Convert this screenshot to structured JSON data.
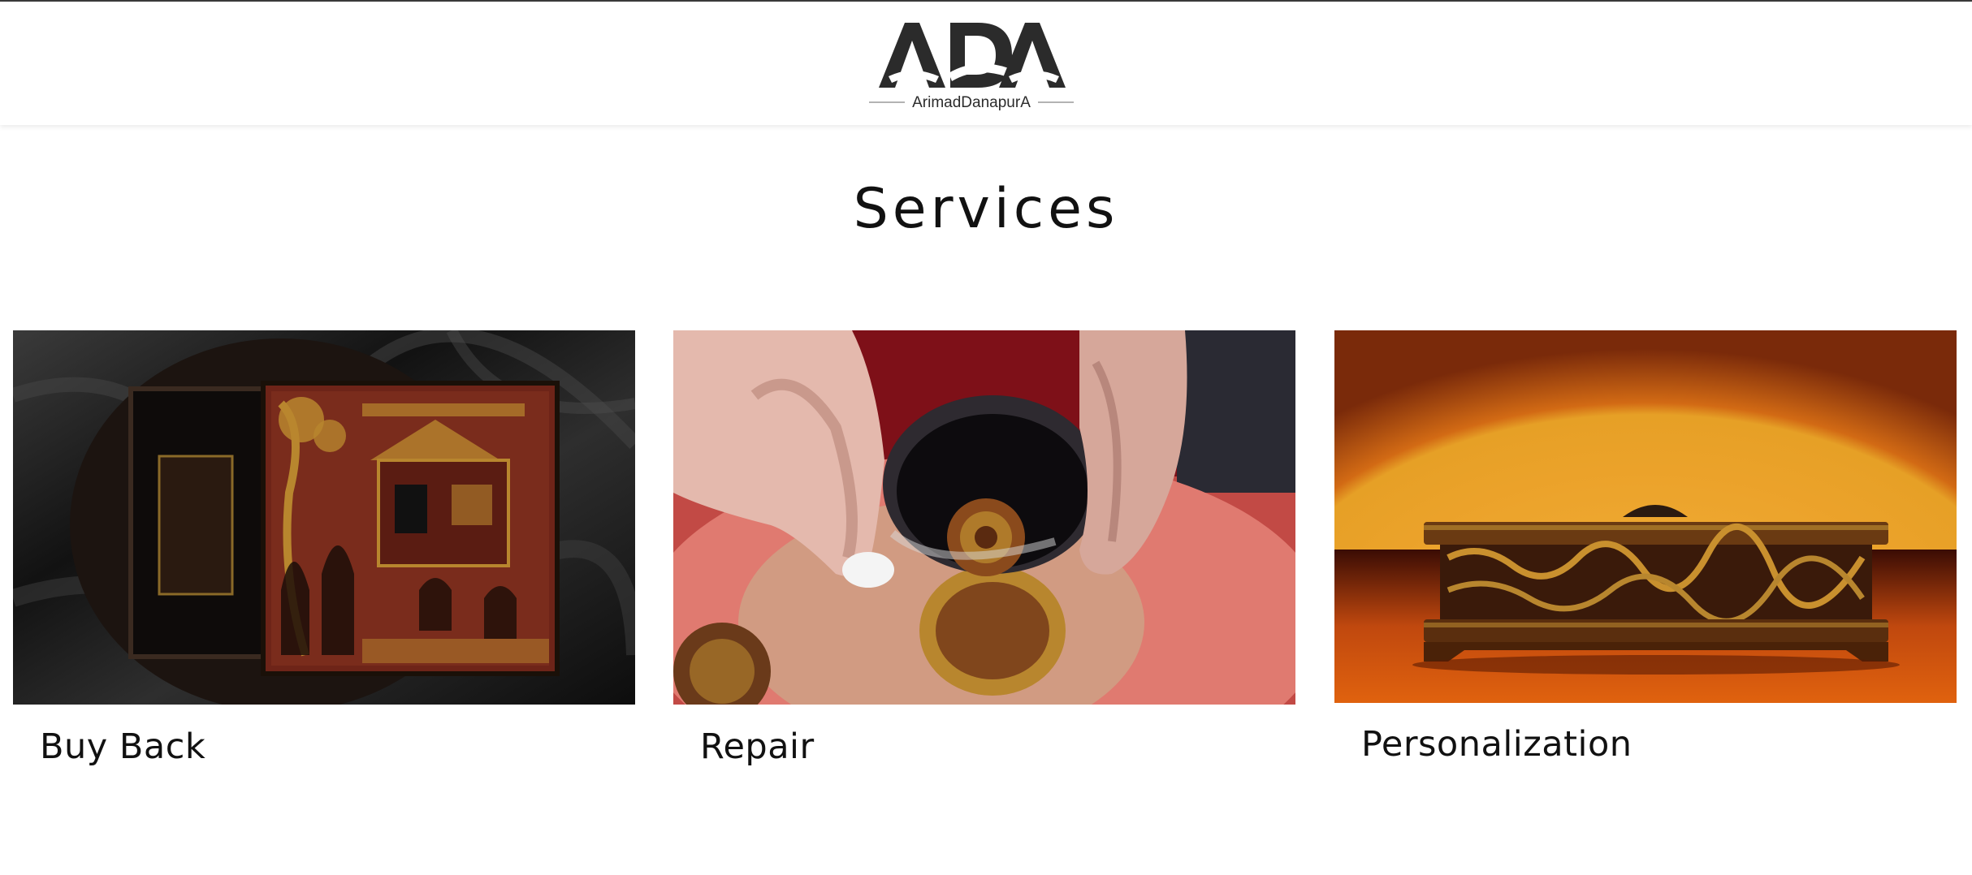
{
  "header": {
    "logo_text": "ADA",
    "logo_subtitle": "ArimadDanapurA"
  },
  "main": {
    "title": "Services",
    "services": [
      {
        "label": "Buy Back",
        "image": "black-lacquer-box-photo"
      },
      {
        "label": "Repair",
        "image": "hands-cleaning-lacquer-bowl-photo"
      },
      {
        "label": "Personalization",
        "image": "orange-lacquer-stand-photo"
      }
    ]
  },
  "colors": {
    "text": "#111111",
    "logo": "#2b2b2b",
    "lacquer_gold": "#b8862e",
    "lacquer_red": "#8a2a1c",
    "sunset_orange": "#e9a22c"
  }
}
